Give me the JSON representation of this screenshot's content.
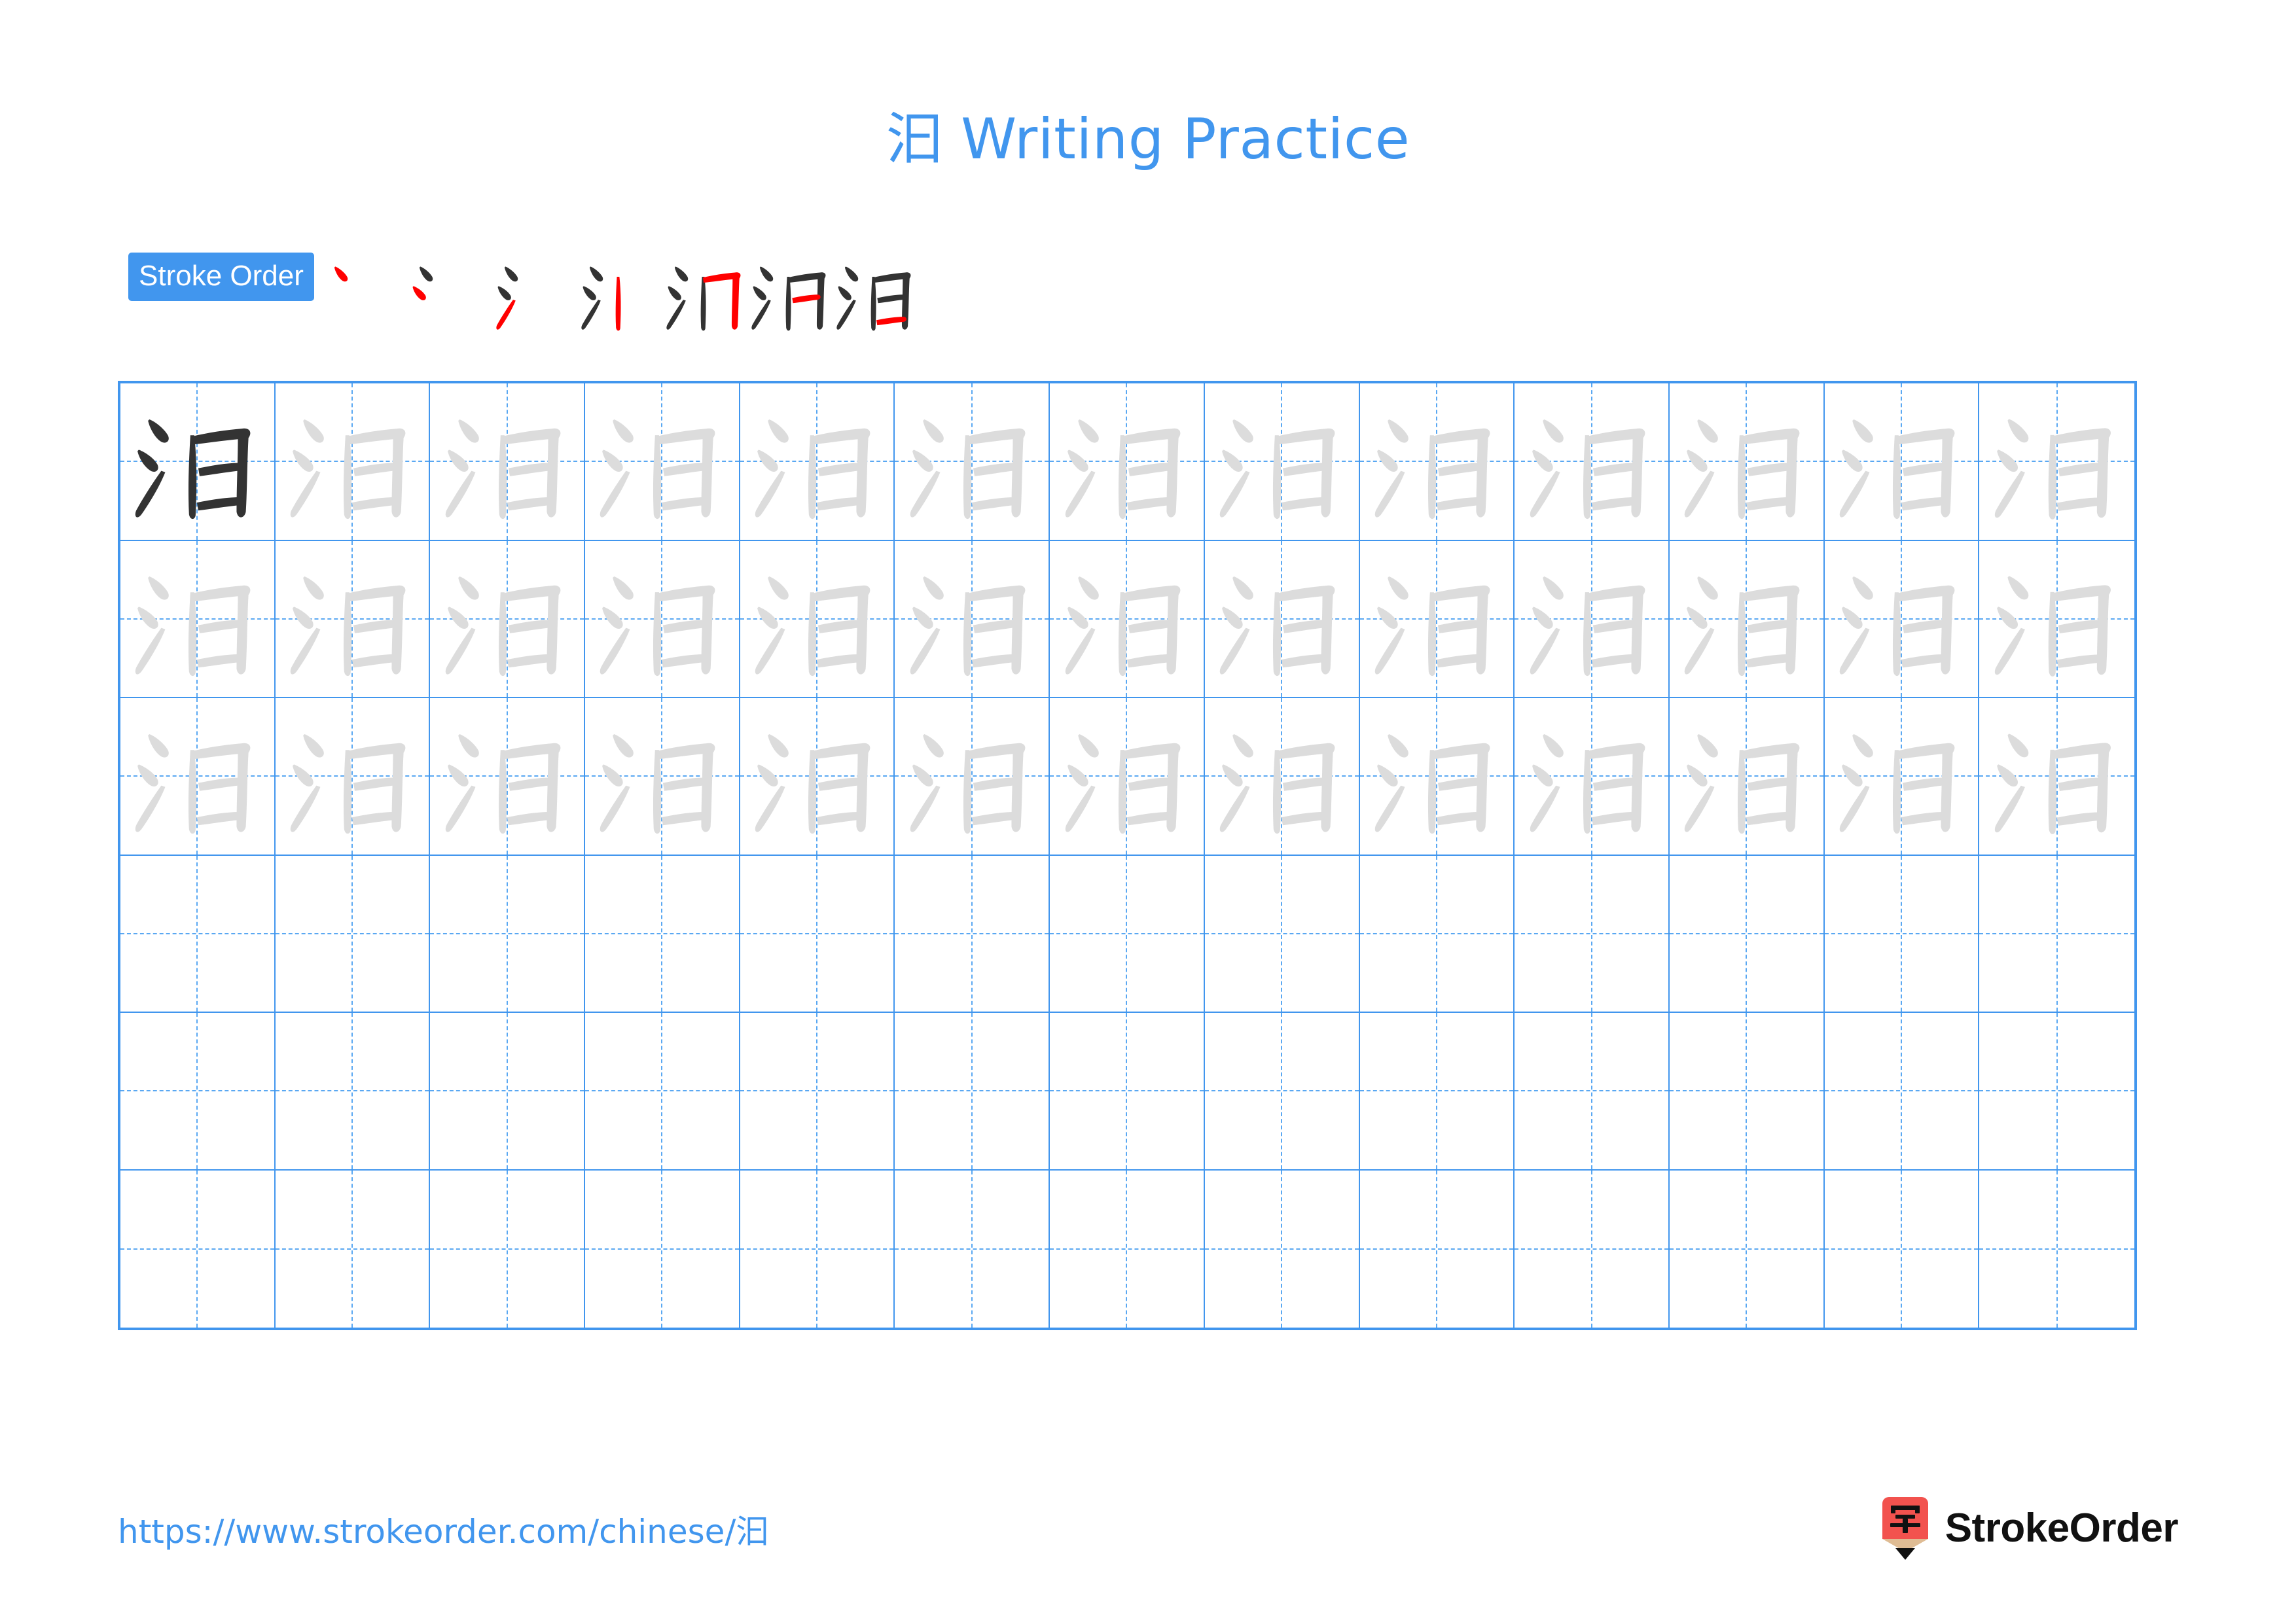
{
  "page": {
    "character": "汩",
    "title": "汩 Writing Practice",
    "background_color": "#ffffff",
    "accent_color": "#4196ee"
  },
  "stroke_order": {
    "badge_label": "Stroke Order",
    "badge_bg": "#4196ee",
    "badge_text_color": "#ffffff",
    "total_strokes": 7,
    "new_stroke_color": "#ff0000",
    "existing_stroke_color": "#333333",
    "steps": [
      {
        "index": 1,
        "new_stroke": "dot (丶)",
        "strokes_shown": 1
      },
      {
        "index": 2,
        "new_stroke": "dot (丶)",
        "strokes_shown": 2
      },
      {
        "index": 3,
        "new_stroke": "rising stroke (提)",
        "strokes_shown": 3
      },
      {
        "index": 4,
        "new_stroke": "vertical (丨)",
        "strokes_shown": 4
      },
      {
        "index": 5,
        "new_stroke": "horizontal-turn-vertical (横折)",
        "strokes_shown": 5
      },
      {
        "index": 6,
        "new_stroke": "horizontal (一)",
        "strokes_shown": 6
      },
      {
        "index": 7,
        "new_stroke": "horizontal (一)",
        "strokes_shown": 7
      }
    ]
  },
  "practice_grid": {
    "columns": 13,
    "rows": 6,
    "grid_line_color": "#4196ee",
    "guide_line_color": "#5aa8f2",
    "model_glyph_color": "#333333",
    "trace_glyph_color": "#dcdcdc",
    "rows_detail": [
      {
        "row": 1,
        "model_cells": 1,
        "trace_cells": 12,
        "blank_cells": 0
      },
      {
        "row": 2,
        "model_cells": 0,
        "trace_cells": 13,
        "blank_cells": 0
      },
      {
        "row": 3,
        "model_cells": 0,
        "trace_cells": 13,
        "blank_cells": 0
      },
      {
        "row": 4,
        "model_cells": 0,
        "trace_cells": 0,
        "blank_cells": 13
      },
      {
        "row": 5,
        "model_cells": 0,
        "trace_cells": 0,
        "blank_cells": 13
      },
      {
        "row": 6,
        "model_cells": 0,
        "trace_cells": 0,
        "blank_cells": 13
      }
    ]
  },
  "footer": {
    "url": "https://www.strokeorder.com/chinese/汩",
    "url_color": "#4196ee",
    "brand_name": "StrokeOrder",
    "brand_mark_character": "字",
    "brand_mark_body_color": "#f2524e",
    "brand_mark_wood_color": "#dfbc94",
    "brand_mark_tip_color": "#111111"
  }
}
